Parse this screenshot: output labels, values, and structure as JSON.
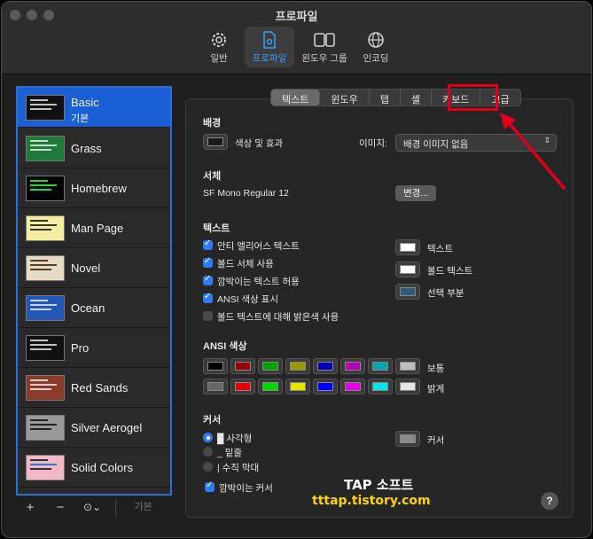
{
  "window": {
    "title": "프로파일"
  },
  "toolbar": [
    {
      "label": "일반",
      "icon": "gear-icon"
    },
    {
      "label": "프로파일",
      "icon": "profile-document-icon"
    },
    {
      "label": "윈도우 그룹",
      "icon": "window-group-icon"
    },
    {
      "label": "인코딩",
      "icon": "globe-icon"
    }
  ],
  "profiles": [
    {
      "name": "Basic",
      "sub": "기본",
      "bg": "#ffffff"
    },
    {
      "name": "Grass",
      "sub": "",
      "bg": "#1f7a3a"
    },
    {
      "name": "Homebrew",
      "sub": "",
      "bg": "#050505"
    },
    {
      "name": "Man Page",
      "sub": "",
      "bg": "#f4ec9e"
    },
    {
      "name": "Novel",
      "sub": "",
      "bg": "#e6dcc6"
    },
    {
      "name": "Ocean",
      "sub": "",
      "bg": "#2456b5"
    },
    {
      "name": "Pro",
      "sub": "",
      "bg": "#111111"
    },
    {
      "name": "Red Sands",
      "sub": "",
      "bg": "#8a3b2c"
    },
    {
      "name": "Silver Aerogel",
      "sub": "",
      "bg": "#9a9a9a"
    },
    {
      "name": "Solid Colors",
      "sub": "",
      "bg": "#f1b8c8"
    }
  ],
  "sidebar_footer": {
    "add": "+",
    "remove": "−",
    "more": "⊙⌄",
    "default": "기본"
  },
  "tabs": [
    "텍스트",
    "윈도우",
    "탭",
    "셸",
    "키보드",
    "고급"
  ],
  "background": {
    "heading": "배경",
    "color_effects": "색상 및 효과",
    "image_label": "이미지:",
    "image_value": "배경 이미지 없음"
  },
  "font": {
    "heading": "서체",
    "value": "SF Mono Regular 12",
    "change": "변경..."
  },
  "text": {
    "heading": "텍스트",
    "options": [
      {
        "label": "안티 앨리어스 텍스트",
        "checked": true
      },
      {
        "label": "볼드 서체 사용",
        "checked": true
      },
      {
        "label": "깜박이는 텍스트 허용",
        "checked": true
      },
      {
        "label": "ANSI 색상 표시",
        "checked": true
      },
      {
        "label": "볼드 텍스트에 대해 밝은색 사용",
        "checked": false
      }
    ],
    "colors": [
      {
        "label": "텍스트",
        "color": "#ffffff"
      },
      {
        "label": "볼드 텍스트",
        "color": "#ffffff"
      },
      {
        "label": "선택 부분",
        "color": "#2e5d7c"
      }
    ]
  },
  "ansi": {
    "heading": "ANSI 색상",
    "normal_label": "보통",
    "bright_label": "밝게",
    "normal": [
      "#000000",
      "#990000",
      "#00a600",
      "#999900",
      "#0000b2",
      "#b200b2",
      "#00a6b2",
      "#bfbfbf"
    ],
    "bright": [
      "#666666",
      "#e50000",
      "#00d900",
      "#e5e500",
      "#0000ff",
      "#e500e5",
      "#00e5e5",
      "#e5e5e5"
    ]
  },
  "cursor": {
    "heading": "커서",
    "options": [
      {
        "label": "█ 사각형",
        "selected": true
      },
      {
        "label": "_ 밑줄",
        "selected": false
      },
      {
        "label": "| 수직 막대",
        "selected": false
      }
    ],
    "blink": "깜박이는 커서",
    "color_label": "커서",
    "color": "#8a8a8a"
  },
  "help": "?",
  "watermark": {
    "line1": "TAP 소프트",
    "line2": "tttap.tistory.com"
  }
}
